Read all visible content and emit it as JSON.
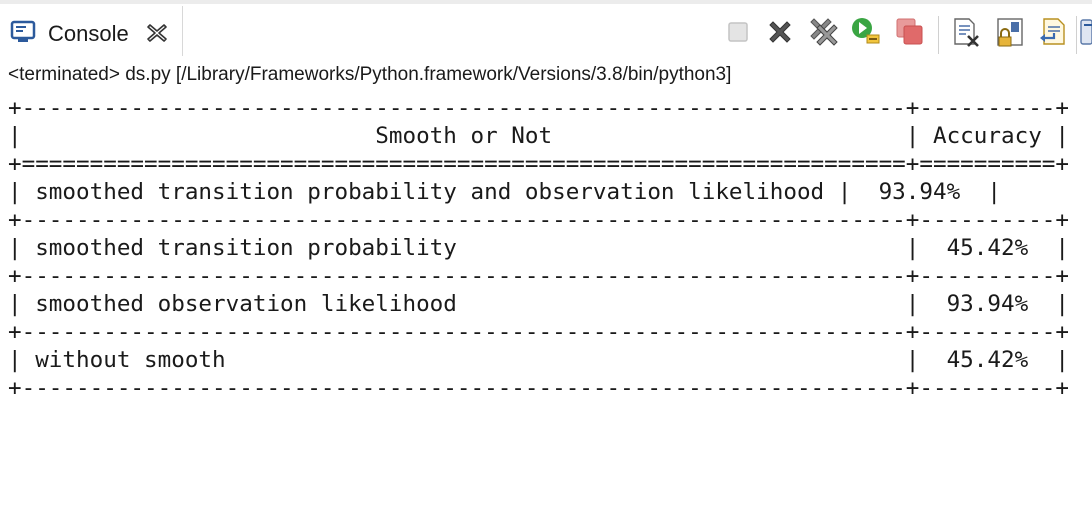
{
  "tab": {
    "title": "Console",
    "icon": "console-icon",
    "close_icon": "close-icon"
  },
  "toolbar": {
    "items": [
      {
        "name": "terminate-button",
        "icon": "stop-icon"
      },
      {
        "name": "remove-launch-button",
        "icon": "remove-x-icon"
      },
      {
        "name": "remove-all-terminated-button",
        "icon": "remove-all-icon"
      },
      {
        "name": "relaunch-button",
        "icon": "relaunch-icon"
      },
      {
        "name": "disconnect-button",
        "icon": "disconnect-icon"
      },
      {
        "name": "clear-console-button",
        "icon": "clear-console-icon"
      },
      {
        "name": "scroll-lock-button",
        "icon": "scroll-lock-icon"
      },
      {
        "name": "word-wrap-button",
        "icon": "word-wrap-icon"
      },
      {
        "name": "display-console-button",
        "icon": "display-console-icon"
      }
    ]
  },
  "status": "<terminated> ds.py [/Library/Frameworks/Python.framework/Versions/3.8/bin/python3]",
  "console": {
    "lines": [
      "+-----------------------------------------------------------------+----------+",
      "|                          Smooth or Not                          | Accuracy |",
      "+=================================================================+==========+",
      "| smoothed transition probability and observation likelihood |  93.94%  |",
      "+-----------------------------------------------------------------+----------+",
      "| smoothed transition probability                                 |  45.42%  |",
      "+-----------------------------------------------------------------+----------+",
      "| smoothed observation likelihood                                 |  93.94%  |",
      "+-----------------------------------------------------------------+----------+",
      "| without smooth                                                  |  45.42%  |",
      "+-----------------------------------------------------------------+----------+"
    ]
  }
}
